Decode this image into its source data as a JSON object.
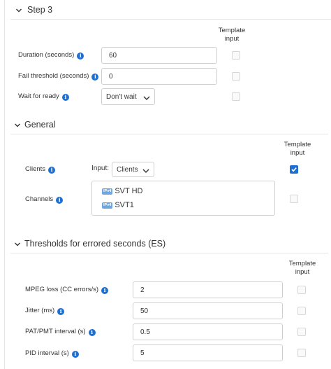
{
  "step3": {
    "title": "Step 3",
    "template_header": [
      "Template",
      "input"
    ],
    "fields": [
      {
        "label": "Duration (seconds)",
        "value": "60",
        "template_checked": false
      },
      {
        "label": "Fail threshold (seconds)",
        "value": "0",
        "template_checked": false
      }
    ],
    "wait_for_ready": {
      "label": "Wait for ready",
      "selected": "Don't wait",
      "template_checked": false
    }
  },
  "general": {
    "title": "General",
    "template_header": [
      "Template",
      "input"
    ],
    "clients": {
      "label": "Clients",
      "input_label": "Input:",
      "selected": "Clients",
      "template_checked": true
    },
    "channels": {
      "label": "Channels",
      "items": [
        {
          "badge": "IPv4",
          "name": "SVT HD"
        },
        {
          "badge": "IPv4",
          "name": "SVT1"
        }
      ],
      "template_checked": false
    }
  },
  "thresholds": {
    "title": "Thresholds for errored seconds (ES)",
    "template_header": [
      "Template",
      "input"
    ],
    "fields": [
      {
        "label": "MPEG loss (CC errors/s)",
        "value": "2",
        "template_checked": false
      },
      {
        "label": "Jitter (ms)",
        "value": "50",
        "template_checked": false
      },
      {
        "label": "PAT/PMT interval (s)",
        "value": "0.5",
        "template_checked": false
      },
      {
        "label": "PID interval (s)",
        "value": "5",
        "template_checked": false
      }
    ]
  },
  "icons": {
    "info": "info-icon",
    "chevron": "chevron-down-icon",
    "check": "check-icon"
  },
  "colors": {
    "accent": "#1f6fd1",
    "border": "#cfcfcf",
    "rule": "#e6e6e6"
  }
}
